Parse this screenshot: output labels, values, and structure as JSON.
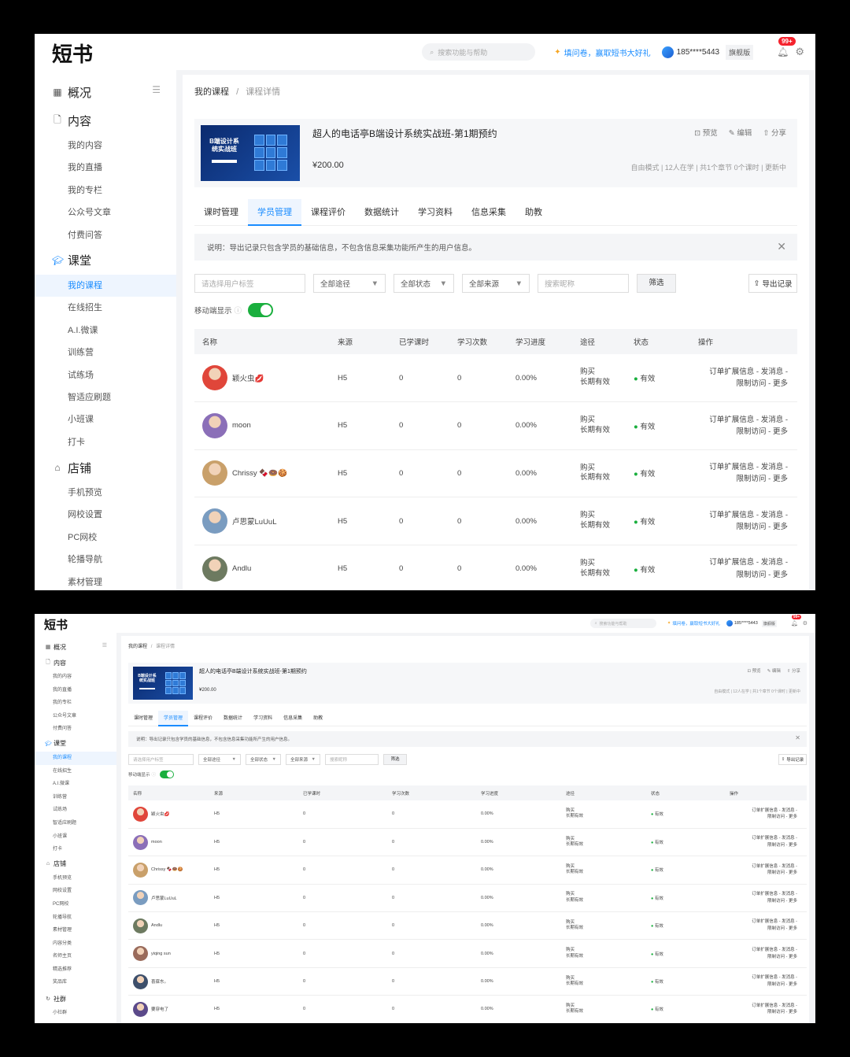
{
  "app": {
    "logo": "短书",
    "header": {
      "search_placeholder": "搜索功能与帮助",
      "invite_text": "填问卷，赢取短书大好礼",
      "phone": "185****5443",
      "edition": "旗舰版",
      "notification_badge": "99+"
    },
    "sidebar": {
      "overview": "概况",
      "groups": [
        {
          "title": "内容",
          "icon": "file-icon",
          "items": [
            "我的内容",
            "我的直播",
            "我的专栏",
            "公众号文章",
            "付费问答"
          ]
        },
        {
          "title": "课堂",
          "icon": "graduation-cap-icon",
          "items": [
            "我的课程",
            "在线招生",
            "A.I.微课",
            "训练营",
            "试练场",
            "智适应刷题",
            "小班课",
            "打卡"
          ]
        },
        {
          "title": "店铺",
          "icon": "store-icon",
          "items": [
            "手机预览",
            "网校设置",
            "PC网校",
            "轮播导航",
            "素材管理",
            "内容分类",
            "名师主页",
            "精选推荐",
            "奖品库"
          ]
        },
        {
          "title": "社群",
          "icon": "refresh-icon",
          "items": [
            "小社群"
          ]
        }
      ],
      "active_item": "我的课程"
    },
    "breadcrumb": {
      "root": "我的课程",
      "separator": "/",
      "current": "课程详情"
    },
    "course": {
      "cover_title": "B端设计系统实战班",
      "title": "超人的电话亭B端设计系统实战班-第1期预约",
      "price": "¥200.00",
      "actions": [
        {
          "icon": "preview-icon",
          "label": "预览"
        },
        {
          "icon": "edit-icon",
          "label": "编辑"
        },
        {
          "icon": "share-icon",
          "label": "分享"
        }
      ],
      "meta": "自由模式 | 12人在学 | 共1个章节 0个课时 | 更新中"
    },
    "tabs": [
      "课时管理",
      "学员管理",
      "课程评价",
      "数据统计",
      "学习资料",
      "信息采集",
      "助教"
    ],
    "active_tab": "学员管理",
    "notice": "说明：导出记录只包含学员的基础信息，不包含信息采集功能所产生的用户信息。",
    "filters": {
      "tag_placeholder": "请选择用户标签",
      "route": "全部途径",
      "status": "全部状态",
      "source": "全部来源",
      "nickname_placeholder": "搜索昵称",
      "filter_button": "筛选",
      "export_button": "导出记录"
    },
    "mobile_display_label": "移动端显示",
    "mobile_display_on": true,
    "table": {
      "columns": [
        "名称",
        "来源",
        "已学课时",
        "学习次数",
        "学习进度",
        "途径",
        "状态",
        "操作"
      ],
      "route_line1": "购买",
      "route_line2": "长期有效",
      "ops_line1": "订单扩展信息 - 发消息 -",
      "ops_line2": "限制访问 - 更多",
      "rows": [
        {
          "name": "颖火虫💋",
          "avatar_color": "#e0463a",
          "source": "H5",
          "lessons": "0",
          "times": "0",
          "progress": "0.00%",
          "status": "有效"
        },
        {
          "name": "moon",
          "avatar_color": "#8b6fb8",
          "source": "H5",
          "lessons": "0",
          "times": "0",
          "progress": "0.00%",
          "status": "有效"
        },
        {
          "name": "Chrissy 🍫🍩🍪",
          "avatar_color": "#c9a06a",
          "source": "H5",
          "lessons": "0",
          "times": "0",
          "progress": "0.00%",
          "status": "有效"
        },
        {
          "name": "卢思蒙LuUuL",
          "avatar_color": "#7a9cc0",
          "source": "H5",
          "lessons": "0",
          "times": "0",
          "progress": "0.00%",
          "status": "有效"
        },
        {
          "name": "Andlu",
          "avatar_color": "#6d7a60",
          "source": "H5",
          "lessons": "0",
          "times": "0",
          "progress": "0.00%",
          "status": "有效"
        },
        {
          "name": "yiqing sun",
          "avatar_color": "#9a6b5b",
          "source": "H5",
          "lessons": "0",
          "times": "0",
          "progress": "0.00%",
          "status": "有效"
        },
        {
          "name": "喜寐东。",
          "avatar_color": "#3d4f6b",
          "source": "H5",
          "lessons": "0",
          "times": "0",
          "progress": "0.00%",
          "status": "有效"
        },
        {
          "name": "要穿电了",
          "avatar_color": "#5b4a8a",
          "source": "H5",
          "lessons": "0",
          "times": "0",
          "progress": "0.00%",
          "status": "有效"
        }
      ]
    }
  },
  "panel1_visible_rows": 5,
  "panel2_visible_rows": 8,
  "colors": {
    "accent": "#1a8cff",
    "success": "#1aaf3e",
    "badge": "#f5222d"
  }
}
